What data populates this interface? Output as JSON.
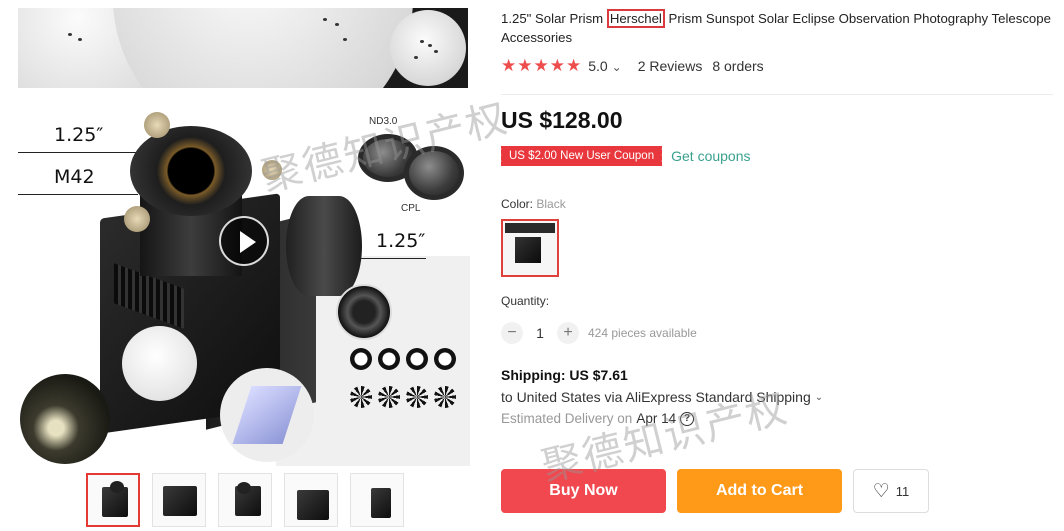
{
  "product": {
    "title_before": "1.25\" Solar Prism ",
    "title_highlight": "Herschel",
    "title_after": " Prism Sunspot Solar Eclipse Observation Photography Telescope Accessories",
    "rating_stars": "★★★★★",
    "rating_value": "5.0",
    "rating_chevron": "⌄",
    "reviews": "2 Reviews",
    "orders": "8 orders",
    "price": "US $128.00"
  },
  "coupon": {
    "label": "US $2.00 New User Coupon",
    "action": "Get coupons"
  },
  "color": {
    "label": "Color: ",
    "value": "Black"
  },
  "quantity": {
    "label": "Quantity:",
    "minus": "−",
    "value": "1",
    "plus": "+",
    "available": "424 pieces available"
  },
  "shipping": {
    "title": "Shipping: US $7.61",
    "destination": "to United States via AliExpress Standard Shipping",
    "chevron": "⌄",
    "delivery_label": "Estimated Delivery on",
    "delivery_date": "Apr 14",
    "help_icon": "?"
  },
  "actions": {
    "buy_now": "Buy Now",
    "add_to_cart": "Add to Cart",
    "wishlist_icon": "♡",
    "wishlist_count": "11"
  },
  "image_labels": {
    "dim_top": "1.25″",
    "dim_m42": "M42",
    "dim_side": "1.25″",
    "filter_nd": "ND3.0",
    "filter_cpl": "CPL"
  },
  "watermark": {
    "text": "聚德知识产权"
  },
  "colors": {
    "accent_red": "#f0484e",
    "accent_orange": "#ff9a19",
    "coupon_red": "#e8383d",
    "link_teal": "#3aa18f",
    "star_red": "#ee4d4d"
  }
}
